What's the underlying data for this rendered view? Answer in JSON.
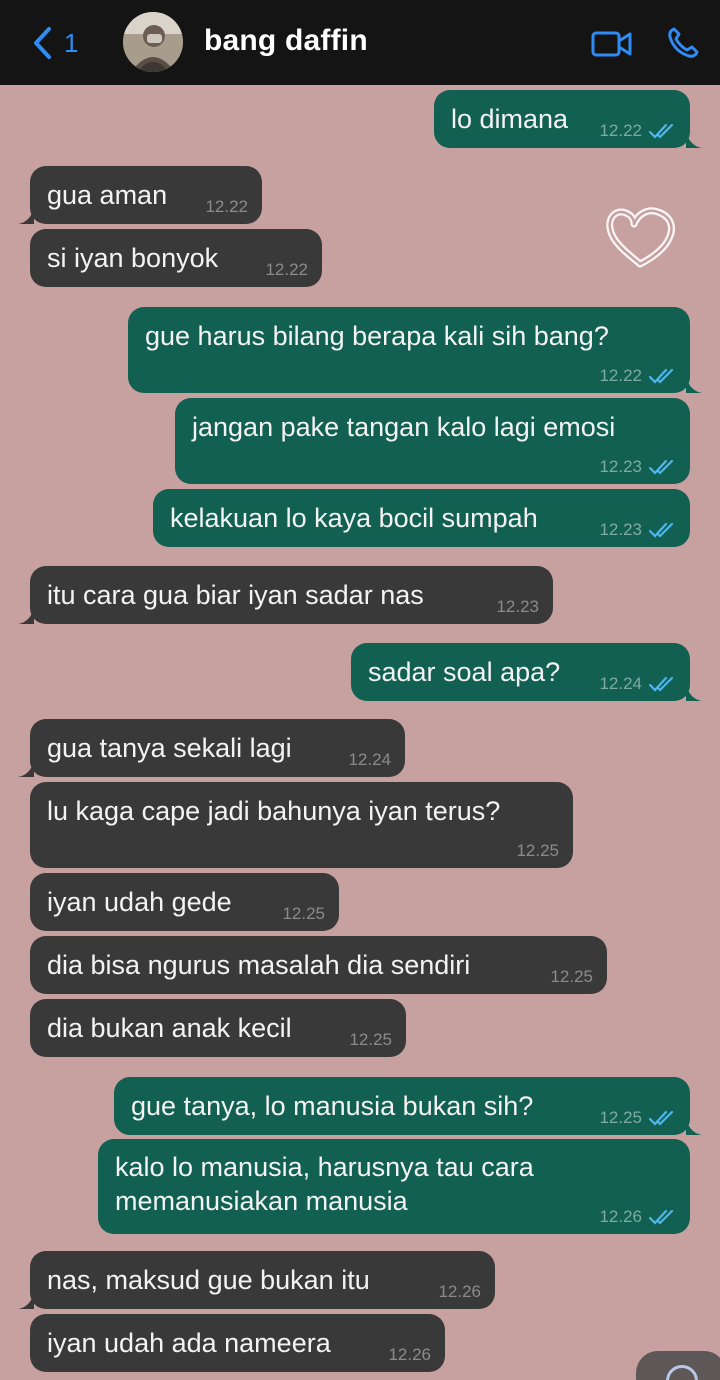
{
  "header": {
    "back_count": "1",
    "contact_name": "bang daffin",
    "accent_color": "#2f8cf4"
  },
  "messages": [
    {
      "dir": "out",
      "text": "lo dimana",
      "time": "12.22",
      "read": true
    },
    {
      "dir": "in",
      "text": "gua aman",
      "time": "12.22"
    },
    {
      "dir": "in",
      "text": "si iyan bonyok",
      "time": "12.22"
    },
    {
      "dir": "out",
      "text": "gue harus bilang berapa kali sih bang?",
      "time": "12.22",
      "read": true
    },
    {
      "dir": "out",
      "text": "jangan pake tangan kalo lagi emosi",
      "time": "12.23",
      "read": true
    },
    {
      "dir": "out",
      "text": "kelakuan lo kaya bocil sumpah",
      "time": "12.23",
      "read": true
    },
    {
      "dir": "in",
      "text": "itu cara gua biar iyan sadar nas",
      "time": "12.23"
    },
    {
      "dir": "out",
      "text": "sadar soal apa?",
      "time": "12.24",
      "read": true
    },
    {
      "dir": "in",
      "text": "gua tanya sekali lagi",
      "time": "12.24"
    },
    {
      "dir": "in",
      "text": "lu kaga cape jadi bahunya iyan terus?",
      "time": "12.25"
    },
    {
      "dir": "in",
      "text": "iyan udah gede",
      "time": "12.25"
    },
    {
      "dir": "in",
      "text": "dia bisa ngurus masalah dia sendiri",
      "time": "12.25"
    },
    {
      "dir": "in",
      "text": "dia bukan anak kecil",
      "time": "12.25"
    },
    {
      "dir": "out",
      "text": "gue tanya, lo manusia bukan sih?",
      "time": "12.25",
      "read": true
    },
    {
      "dir": "out",
      "text": "kalo lo manusia, harusnya tau cara memanusiakan manusia",
      "time": "12.26",
      "read": true
    },
    {
      "dir": "in",
      "text": "nas, maksud gue bukan itu",
      "time": "12.26"
    },
    {
      "dir": "in",
      "text": "iyan udah ada nameera",
      "time": "12.26"
    }
  ],
  "icons": {
    "back": "chevron-left-icon",
    "video": "video-camera-icon",
    "call": "phone-icon",
    "sticker": "heart-icon",
    "read_receipt": "double-check-icon"
  },
  "colors": {
    "background": "#c7a19f",
    "incoming_bubble": "#393939",
    "outgoing_bubble": "#116052",
    "read_tick": "#4fb6ec"
  }
}
